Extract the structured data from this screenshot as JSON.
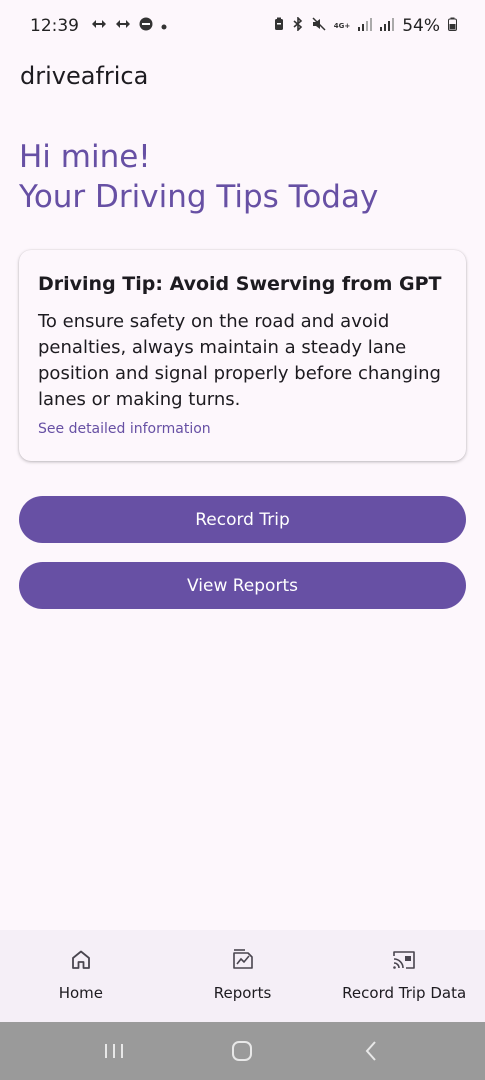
{
  "status_bar": {
    "time": "12:39",
    "notification_icons": [
      "roaming-icon",
      "roaming-icon",
      "dnd-icon",
      "dot-icon"
    ],
    "system_icons": [
      "battery-saver-icon",
      "bluetooth-icon",
      "mute-icon",
      "4g-icon",
      "signal-icon",
      "signal-icon"
    ],
    "network_label": "4G+",
    "battery": "54%"
  },
  "app": {
    "title": "driveafrica"
  },
  "greeting": {
    "line1": "Hi mine!",
    "line2": "Your Driving Tips Today"
  },
  "tip_card": {
    "title": "Driving Tip: Avoid Swerving from GPT",
    "body": "To ensure safety on the road and avoid penalties, always maintain a steady lane position and signal properly before changing lanes or making turns.",
    "link": "See detailed information"
  },
  "buttons": {
    "record_trip": "Record Trip",
    "view_reports": "View Reports"
  },
  "bottom_nav": {
    "items": [
      {
        "label": "Home",
        "icon": "home-icon"
      },
      {
        "label": "Reports",
        "icon": "reports-icon"
      },
      {
        "label": "Record Trip Data",
        "icon": "cast-icon"
      }
    ]
  },
  "system_nav": {
    "buttons": [
      "recents-icon",
      "home-circle-icon",
      "back-icon"
    ]
  },
  "colors": {
    "primary": "#6750a4",
    "background": "#fdf7fc",
    "nav_background": "#f5eff7",
    "system_nav": "#9a9a9a"
  }
}
